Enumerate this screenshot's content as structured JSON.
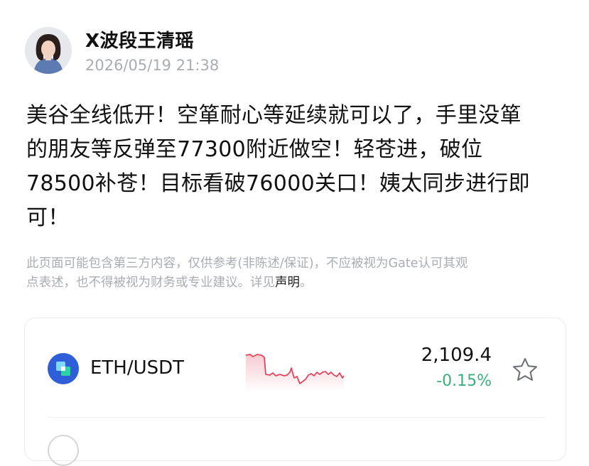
{
  "post": {
    "author": "X波段王清瑶",
    "timestamp": "2026/05/19 21:38",
    "lines": [
      "美谷全线低开！空箪耐心等延续就可以了，手里没箪",
      "的朋友等反弹至77300附近做空！轻苍进，破位",
      "78500补苍！目标看破76000关口！姨太同步进行即",
      "可！"
    ]
  },
  "disclaimer": {
    "text_line1": "此页面可能包含第三方内容，仅供参考(非陈述/保证)，不应被视为Gate认可其观",
    "text_line2": "点表述，也不得被视为财务或专业建议。详见",
    "link": "声明",
    "tail": "。"
  },
  "ticker": {
    "pair": "ETH/USDT",
    "price": "2,109.4",
    "change": "-0.15%",
    "logo_icon": "eth-coin-icon",
    "colors": {
      "down_line": "#e0475f",
      "change_text": "#3cae7c",
      "logo_bg": "#2f5fd8"
    }
  }
}
